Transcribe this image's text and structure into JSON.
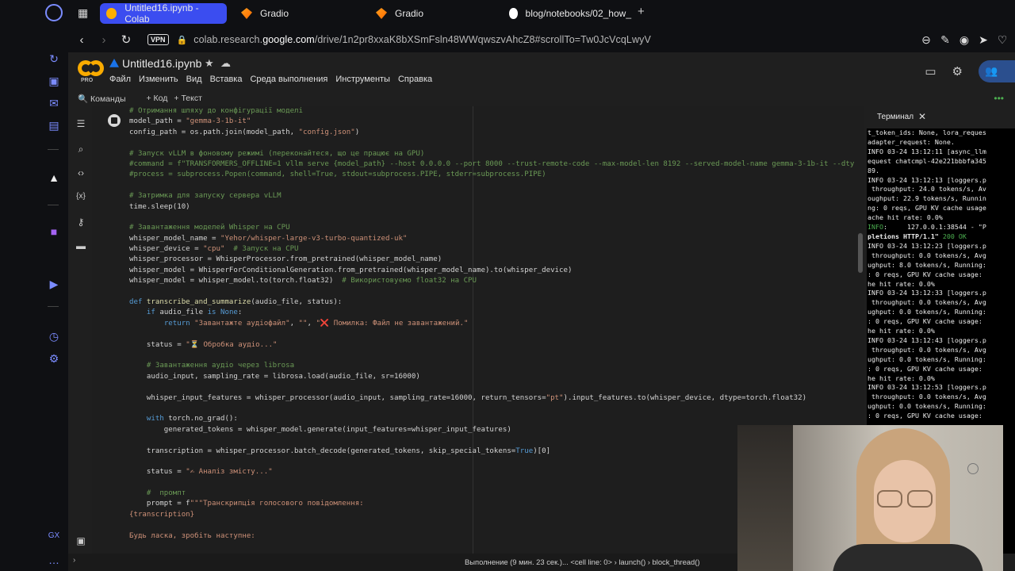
{
  "browser": {
    "tabs": [
      {
        "title": "Untitled16.ipynb - Colab",
        "active": true,
        "icon": "colab-icon"
      },
      {
        "title": "Gradio",
        "active": false,
        "icon": "gradio-icon"
      },
      {
        "title": "Gradio",
        "active": false,
        "icon": "gradio-icon"
      },
      {
        "title": "blog/notebooks/02_how_",
        "active": false,
        "icon": "github-icon"
      }
    ],
    "new_tab": "+",
    "vpn_label": "VPN",
    "url_prefix": "colab.research.",
    "url_domain": "google.com",
    "url_path": "/drive/1n2pr8xxaK8bXSmFsln48WWqwszvAhcZ8#scrollTo=Tw0JcVcqLwyV"
  },
  "colab": {
    "logo_badge": "PRO",
    "notebook_title": "Untitled16.ipynb",
    "menu": [
      "Файл",
      "Изменить",
      "Вид",
      "Вставка",
      "Среда выполнения",
      "Инструменты",
      "Справка"
    ],
    "toolbar": {
      "commands": "Команды",
      "add_code": "+ Код",
      "add_text": "+ Текст"
    }
  },
  "code_lines": [
    [
      [
        "cm",
        "# Отримання шляху до конфігурації моделі"
      ]
    ],
    [
      [
        "",
        "model_path = "
      ],
      [
        "st",
        "\"gemma-3-1b-it\""
      ]
    ],
    [
      [
        "",
        "config_path = os.path.join(model_path, "
      ],
      [
        "st",
        "\"config.json\""
      ],
      [
        "",
        ")"
      ]
    ],
    [],
    [
      [
        "cm",
        "# Запуск vLLM в фоновому режимі (переконайтеся, що це працює на GPU)"
      ]
    ],
    [
      [
        "cm",
        "#command = f\"TRANSFORMERS_OFFLINE=1 vllm serve {model_path} --host 0.0.0.0 --port 8000 --trust-remote-code --max-model-len 8192 --served-model-name gemma-3-1b-it --dtyp"
      ]
    ],
    [
      [
        "cm",
        "#process = subprocess.Popen(command, shell=True, stdout=subprocess.PIPE, stderr=subprocess.PIPE)"
      ]
    ],
    [],
    [
      [
        "cm",
        "# Затримка для запуску сервера vLLM"
      ]
    ],
    [
      [
        "",
        "time.sleep(10)"
      ]
    ],
    [],
    [
      [
        "cm",
        "# Завантаження моделей Whisper на CPU"
      ]
    ],
    [
      [
        "",
        "whisper_model_name = "
      ],
      [
        "st",
        "\"Yehor/whisper-large-v3-turbo-quantized-uk\""
      ]
    ],
    [
      [
        "",
        "whisper_device = "
      ],
      [
        "st",
        "\"cpu\""
      ],
      [
        "cm",
        "  # Запуск на CPU"
      ]
    ],
    [
      [
        "",
        "whisper_processor = WhisperProcessor.from_pretrained(whisper_model_name)"
      ]
    ],
    [
      [
        "",
        "whisper_model = WhisperForConditionalGeneration.from_pretrained(whisper_model_name).to(whisper_device)"
      ]
    ],
    [
      [
        "",
        "whisper_model = whisper_model.to(torch.float32)"
      ],
      [
        "cm",
        "  # Використовуємо float32 на CPU"
      ]
    ],
    [],
    [
      [
        "kw",
        "def "
      ],
      [
        "fn",
        "transcribe_and_summarize"
      ],
      [
        "",
        "(audio_file, status):"
      ]
    ],
    [
      [
        "",
        "    "
      ],
      [
        "kw",
        "if "
      ],
      [
        "",
        "audio_file "
      ],
      [
        "kw",
        "is None"
      ],
      [
        "",
        ":"
      ]
    ],
    [
      [
        "",
        "        "
      ],
      [
        "kw",
        "return "
      ],
      [
        "st",
        "\"Завантажте аудіофайл\""
      ],
      [
        "",
        ", "
      ],
      [
        "st",
        "\"\""
      ],
      [
        "",
        ", "
      ],
      [
        "st",
        "\"❌ Помилка: Файл не завантажений.\""
      ]
    ],
    [],
    [
      [
        "",
        "    status = "
      ],
      [
        "st",
        "\"⏳ Обробка аудіо...\""
      ]
    ],
    [],
    [
      [
        "cm",
        "    # Завантаження аудіо через librosa"
      ]
    ],
    [
      [
        "",
        "    audio_input, sampling_rate = librosa.load(audio_file, sr=16000)"
      ]
    ],
    [],
    [
      [
        "",
        "    whisper_input_features = whisper_processor(audio_input, sampling_rate=16000, return_tensors="
      ],
      [
        "st",
        "\"pt\""
      ],
      [
        "",
        ").input_features.to(whisper_device, dtype=torch.float32)"
      ]
    ],
    [],
    [
      [
        "",
        "    "
      ],
      [
        "kw",
        "with "
      ],
      [
        "",
        "torch.no_grad():"
      ]
    ],
    [
      [
        "",
        "        generated_tokens = whisper_model.generate(input_features=whisper_input_features)"
      ]
    ],
    [],
    [
      [
        "",
        "    transcription = whisper_processor.batch_decode(generated_tokens, skip_special_tokens="
      ],
      [
        "kw",
        "True"
      ],
      [
        "",
        ")[0]"
      ]
    ],
    [],
    [
      [
        "",
        "    status = "
      ],
      [
        "st",
        "\"✍ Аналіз змісту...\""
      ]
    ],
    [],
    [
      [
        "cm",
        "    #  промпт"
      ]
    ],
    [
      [
        "",
        "    prompt = f"
      ],
      [
        "st",
        "\"\"\"Транскрипція голосового повідомлення:"
      ]
    ],
    [
      [
        "st",
        "{transcription}"
      ]
    ],
    [],
    [
      [
        "st",
        "Будь ласка, зробіть наступне:"
      ]
    ]
  ],
  "terminal": {
    "tab_title": "Терминал",
    "lines": [
      [
        [
          "",
          "t_token_ids: None, lora_reques"
        ]
      ],
      [
        [
          "",
          "adapter_request: None."
        ]
      ],
      [
        [
          "",
          "INFO 03-24 13:12:11 [async_llm"
        ]
      ],
      [
        [
          "",
          "equest chatcmpl-42e221bbbfa345"
        ]
      ],
      [
        [
          "",
          "89."
        ]
      ],
      [
        [
          "",
          "INFO 03-24 13:12:13 [loggers.p"
        ]
      ],
      [
        [
          "",
          " throughput: 24.0 tokens/s, Av"
        ]
      ],
      [
        [
          "",
          "oughput: 22.9 tokens/s, Runnin"
        ]
      ],
      [
        [
          "",
          "ng: 0 reqs, GPU KV cache usage"
        ]
      ],
      [
        [
          "",
          "ache hit rate: 0.0%"
        ]
      ],
      [
        [
          "g",
          "INFO"
        ],
        [
          "",
          ":     127.0.0.1:38544 - \"P"
        ]
      ],
      [
        [
          "b",
          "pletions HTTP/1.1\""
        ],
        [
          "g",
          " 200 OK"
        ]
      ],
      [
        [
          "",
          "INFO 03-24 13:12:23 [loggers.p"
        ]
      ],
      [
        [
          "",
          " throughput: 0.0 tokens/s, Avg"
        ]
      ],
      [
        [
          "",
          "ughput: 8.0 tokens/s, Running:"
        ]
      ],
      [
        [
          "",
          ": 0 reqs, GPU KV cache usage: "
        ]
      ],
      [
        [
          "",
          "he hit rate: 0.0%"
        ]
      ],
      [
        [
          "",
          "INFO 03-24 13:12:33 [loggers.p"
        ]
      ],
      [
        [
          "",
          " throughput: 0.0 tokens/s, Avg"
        ]
      ],
      [
        [
          "",
          "ughput: 0.0 tokens/s, Running:"
        ]
      ],
      [
        [
          "",
          ": 0 reqs, GPU KV cache usage: "
        ]
      ],
      [
        [
          "",
          "he hit rate: 0.0%"
        ]
      ],
      [
        [
          "",
          "INFO 03-24 13:12:43 [loggers.p"
        ]
      ],
      [
        [
          "",
          " throughput: 0.0 tokens/s, Avg"
        ]
      ],
      [
        [
          "",
          "ughput: 0.0 tokens/s, Running:"
        ]
      ],
      [
        [
          "",
          ": 0 reqs, GPU KV cache usage: "
        ]
      ],
      [
        [
          "",
          "he hit rate: 0.0%"
        ]
      ],
      [
        [
          "",
          "INFO 03-24 13:12:53 [loggers.p"
        ]
      ],
      [
        [
          "",
          " throughput: 0.0 tokens/s, Avg"
        ]
      ],
      [
        [
          "",
          "ughput: 0.0 tokens/s, Running:"
        ]
      ],
      [
        [
          "",
          ": 0 reqs, GPU KV cache usage: "
        ]
      ]
    ]
  },
  "statusbar": {
    "message": "Выполнение (9 мин. 23 сек.)... <cell line: 0> › launch() › block_thread()"
  },
  "colors": {
    "accent": "#3b4df0",
    "comment": "#6a9955",
    "string": "#ce9178",
    "keyword": "#569cd6",
    "terminal_ok": "#4caf50"
  }
}
